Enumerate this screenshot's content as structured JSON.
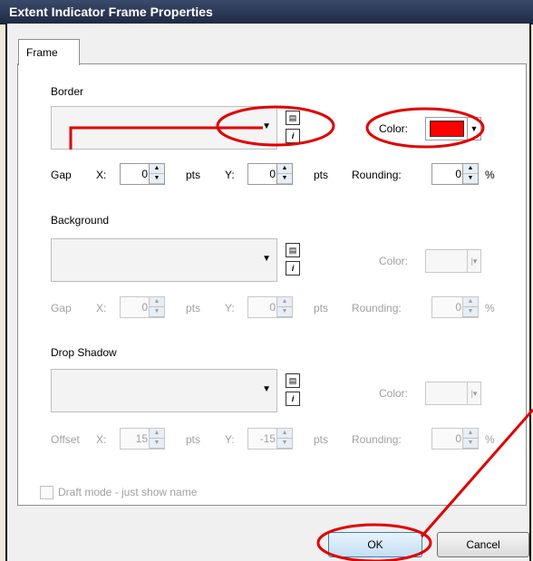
{
  "window": {
    "title": "Extent Indicator Frame Properties"
  },
  "tabs": [
    {
      "label": "Frame"
    }
  ],
  "border": {
    "label": "Border",
    "color_label": "Color:",
    "color": "#ff0000",
    "gap_label": "Gap",
    "x_label": "X:",
    "x_value": "0",
    "y_label": "Y:",
    "y_value": "0",
    "pts": "pts",
    "rounding_label": "Rounding:",
    "rounding_value": "0",
    "percent": "%"
  },
  "background": {
    "label": "Background",
    "color_label": "Color:",
    "gap_label": "Gap",
    "x_label": "X:",
    "x_value": "0",
    "y_label": "Y:",
    "y_value": "0",
    "pts": "pts",
    "rounding_label": "Rounding:",
    "rounding_value": "0",
    "percent": "%"
  },
  "drop_shadow": {
    "label": "Drop Shadow",
    "color_label": "Color:",
    "offset_label": "Offset",
    "x_label": "X:",
    "x_value": "15",
    "y_label": "Y:",
    "y_value": "-15",
    "pts": "pts",
    "rounding_label": "Rounding:",
    "rounding_value": "0",
    "percent": "%"
  },
  "draft_mode": {
    "label": "Draft mode - just show name"
  },
  "buttons": {
    "ok": "OK",
    "cancel": "Cancel"
  },
  "annotation_color": "#e00000"
}
